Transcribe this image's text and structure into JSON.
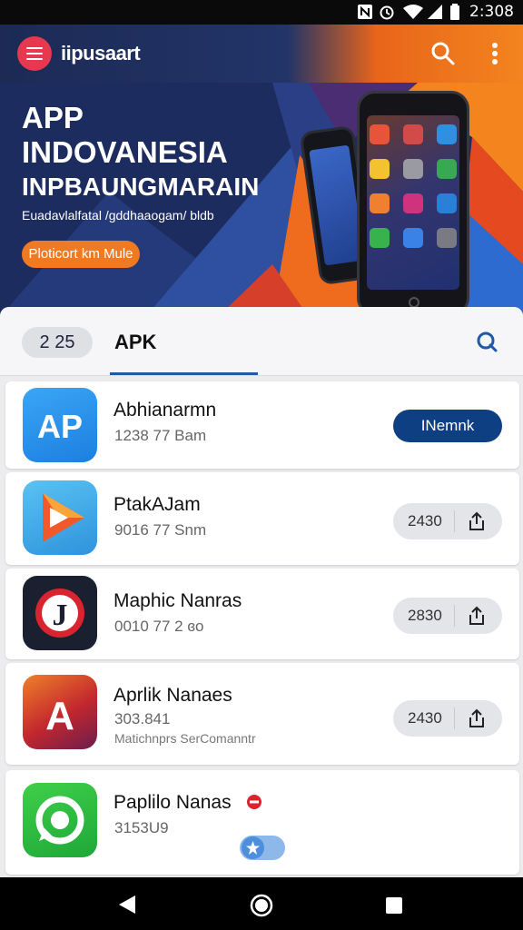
{
  "status_bar": {
    "time": "2:308"
  },
  "app_bar": {
    "title": "iipusaart"
  },
  "banner": {
    "line1": "APP",
    "line2": "INDOVANESIA",
    "line3": "INPBAUNGMARAIN",
    "subtitle": "Euadavlalfatal /gddhaaogam/ bldb",
    "cta": "Ploticort km Mule"
  },
  "tabs": {
    "count": "2 25",
    "active": "APK"
  },
  "apps": [
    {
      "name": "Abhianarmn",
      "meta": "1238 77 Bam",
      "action": "INemnk"
    },
    {
      "name": "PtakAJam",
      "meta": "9016 77 Snm",
      "downloads": "2430"
    },
    {
      "name": "Maphic Nanras",
      "meta": "0010 77 2 ɞo",
      "downloads": "2830"
    },
    {
      "name": "Aprlik Nanaes",
      "meta": "303.841",
      "meta2": "Matichnprs SerComanntr",
      "downloads": "2430"
    },
    {
      "name": "Paplilo Nanas",
      "meta": "3153U9"
    }
  ],
  "colors": {
    "accent": "#0f3f83",
    "brand_red": "#e8384f",
    "orange": "#f07a22",
    "banner_bg": "#1d2c5e"
  }
}
